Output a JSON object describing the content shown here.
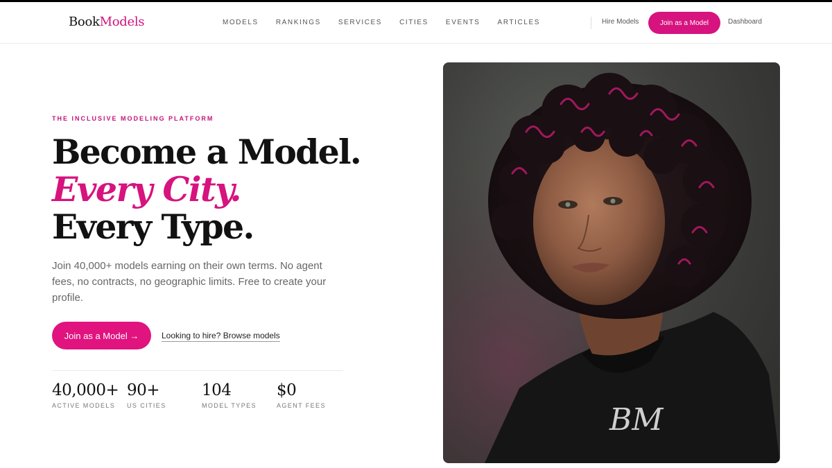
{
  "brand": {
    "name_part1": "Book",
    "name_part2": "Models"
  },
  "nav": {
    "links": [
      "MODELS",
      "RANKINGS",
      "SERVICES",
      "CITIES",
      "EVENTS",
      "ARTICLES"
    ],
    "hire_label": "Hire Models",
    "join_label": "Join as a Model",
    "dashboard_label": "Dashboard"
  },
  "hero": {
    "eyebrow": "THE INCLUSIVE MODELING PLATFORM",
    "headline_line1": "Become a Model.",
    "headline_line2": "Every City.",
    "headline_line3": "Every Type.",
    "description": "Join 40,000+ models earning on their own terms. No agent fees, no contracts, no geographic limits. Free to create your profile.",
    "cta_label": "Join as a Model →",
    "browse_label": "Looking to hire? Browse models",
    "image_logo_text": "BM"
  },
  "stats": [
    {
      "value": "40,000+",
      "label": "ACTIVE MODELS"
    },
    {
      "value": "90+",
      "label": "US CITIES"
    },
    {
      "value": "104",
      "label": "MODEL TYPES"
    },
    {
      "value": "$0",
      "label": "AGENT FEES"
    }
  ],
  "colors": {
    "accent": "#d6137f",
    "text": "#111111",
    "muted": "#666666"
  }
}
